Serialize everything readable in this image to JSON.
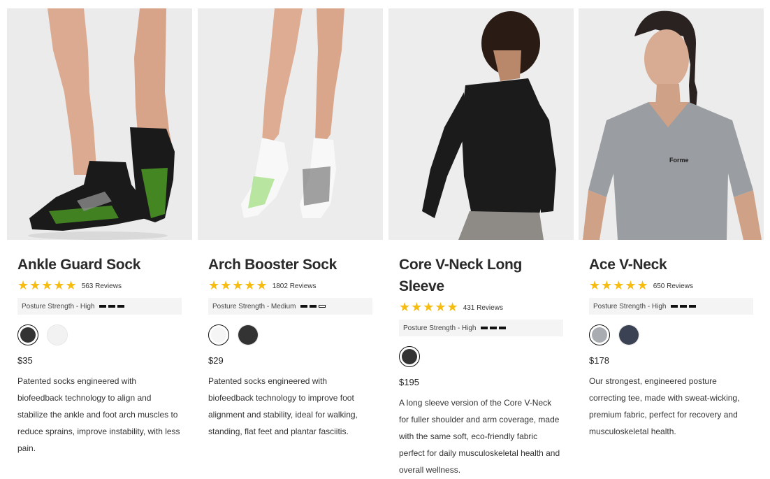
{
  "products": [
    {
      "title": "Ankle Guard Sock",
      "stars": "★★★★★",
      "reviews": "563 Reviews",
      "posture_label": "Posture Strength - High",
      "posture_level": 3,
      "swatches": [
        {
          "color": "#333333",
          "selected": true
        },
        {
          "color": "#f2f2f2",
          "selected": false
        }
      ],
      "price": "$35",
      "description": "Patented socks engineered with biofeedback technology to align and stabilize the ankle and foot arch muscles to reduce sprains, improve instability, with less pain."
    },
    {
      "title": "Arch Booster Sock",
      "stars": "★★★★★",
      "reviews": "1802 Reviews",
      "posture_label": "Posture Strength - Medium",
      "posture_level": 2,
      "swatches": [
        {
          "color": "#f5f5f5",
          "selected": true
        },
        {
          "color": "#333333",
          "selected": false
        }
      ],
      "price": "$29",
      "description": "Patented socks engineered with biofeedback technology to improve foot alignment and stability, ideal for walking, standing, flat feet and plantar fasciitis."
    },
    {
      "title": "Core V-Neck Long Sleeve",
      "stars": "★★★★★",
      "reviews": "431 Reviews",
      "posture_label": "Posture Strength - High",
      "posture_level": 3,
      "swatches": [
        {
          "color": "#333333",
          "selected": true
        }
      ],
      "price": "$195",
      "description": "A long sleeve version of the Core V-Neck for fuller shoulder and arm coverage, made with the same soft, eco-friendly fabric perfect for daily musculoskeletal health and overall wellness."
    },
    {
      "title": "Ace V-Neck",
      "stars": "★★★★★",
      "reviews": "650 Reviews",
      "posture_label": "Posture Strength - High",
      "posture_level": 3,
      "swatches": [
        {
          "color": "#a9acb0",
          "selected": true
        },
        {
          "color": "#3b4253",
          "selected": false
        }
      ],
      "price": "$178",
      "description": "Our strongest, engineered posture correcting tee, made with sweat-wicking, premium fabric, perfect for recovery and musculoskeletal health."
    }
  ],
  "colors": {
    "star": "#f6bc11",
    "posture_bg": "#f4f4f4",
    "photo_bg": "#ececec"
  }
}
